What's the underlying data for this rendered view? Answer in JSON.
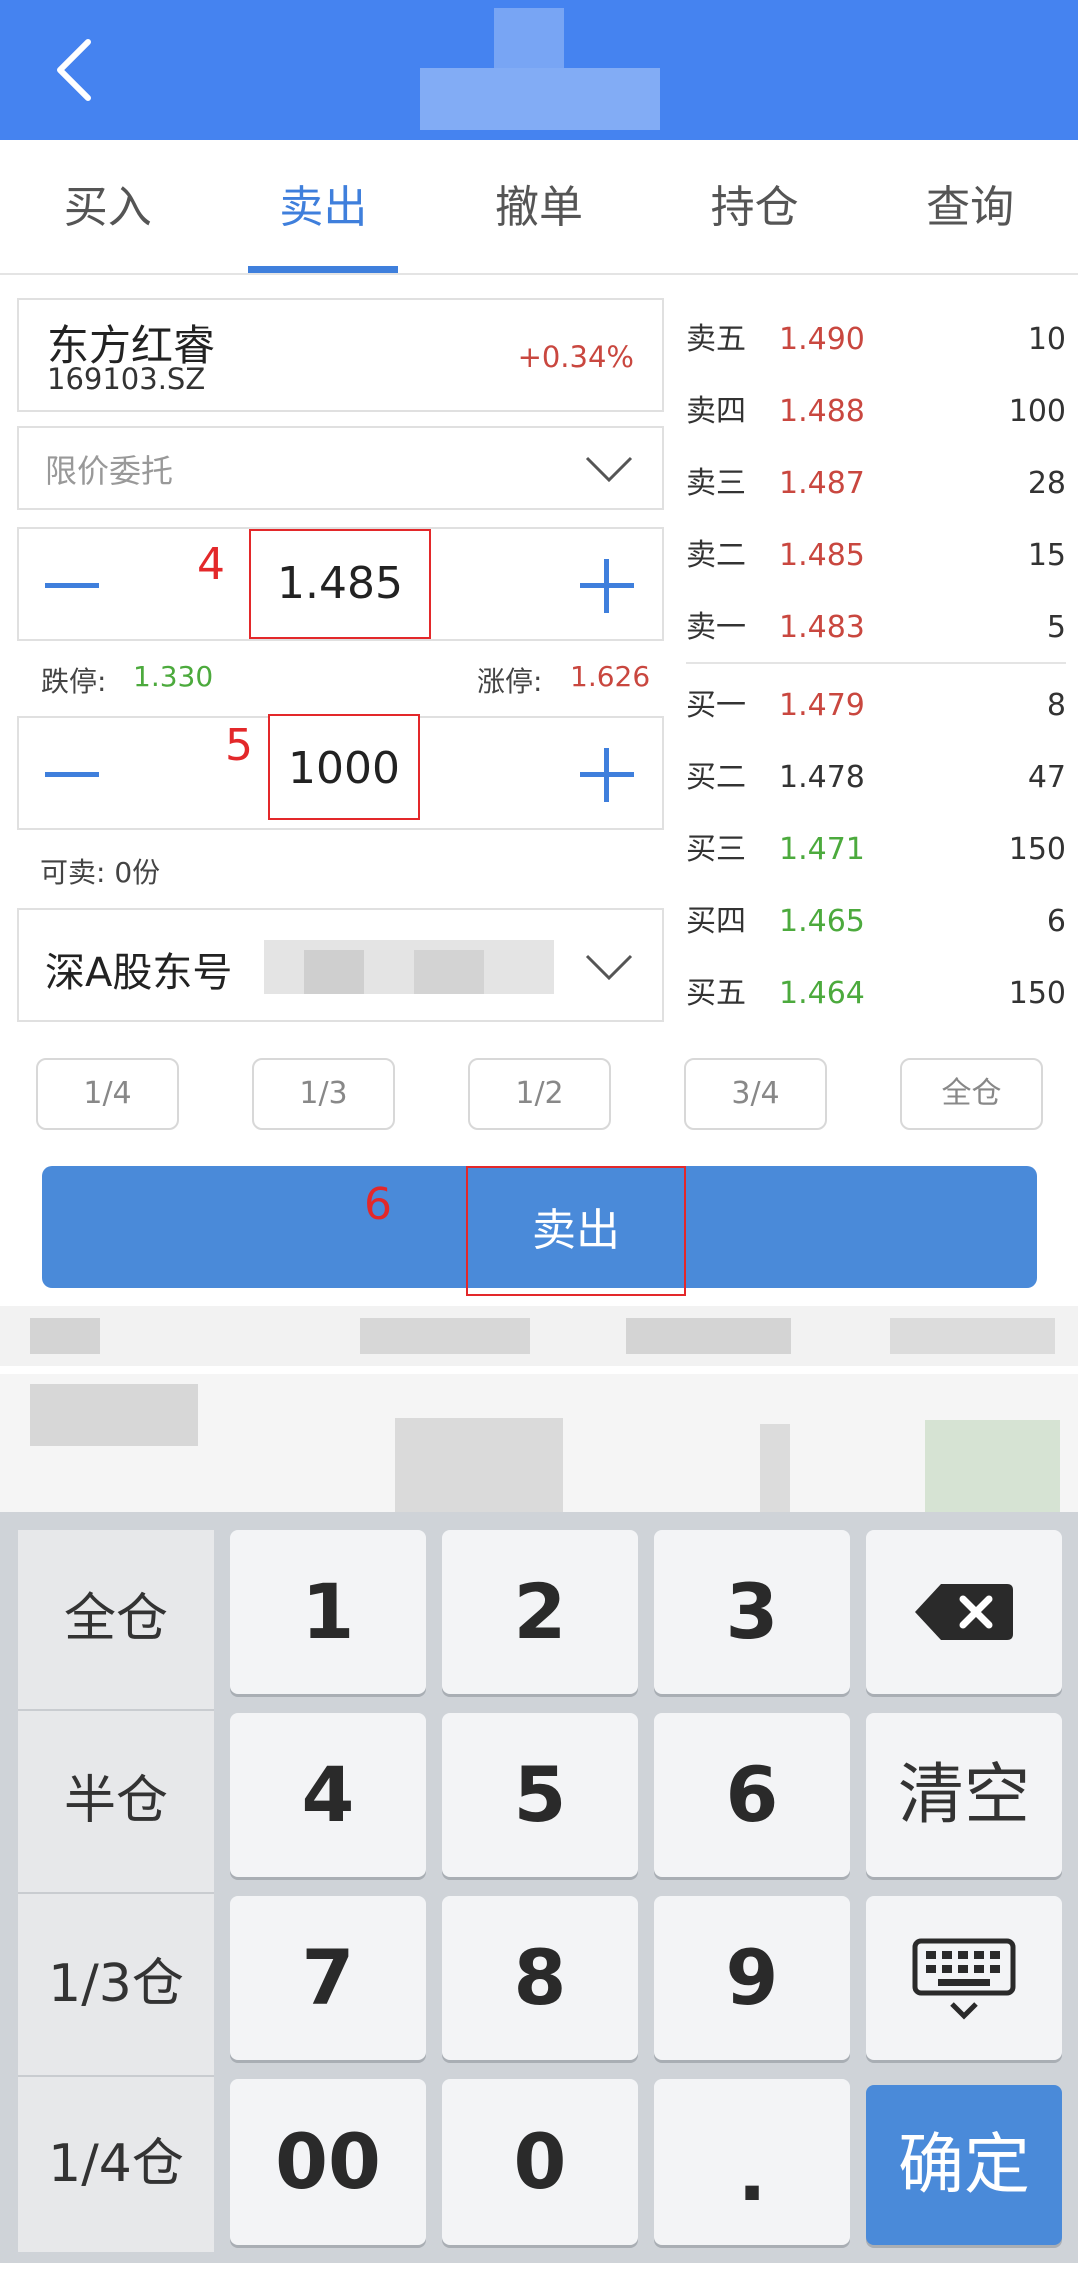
{
  "tabs": [
    {
      "label": "买入"
    },
    {
      "label": "卖出"
    },
    {
      "label": "撤单"
    },
    {
      "label": "持仓"
    },
    {
      "label": "查询"
    }
  ],
  "stock": {
    "name": "东方红睿",
    "code": "169103.SZ",
    "change": "+0.34%"
  },
  "order_type": "限价委托",
  "price": {
    "value": "1.485",
    "annotation": "4",
    "limit_down_label": "跌停:",
    "limit_down": "1.330",
    "limit_up_label": "涨停:",
    "limit_up": "1.626"
  },
  "quantity": {
    "value": "1000",
    "annotation": "5",
    "available": "可卖:  0份"
  },
  "account": {
    "label": "深A股东号"
  },
  "order_book": {
    "asks": [
      {
        "side": "卖五",
        "price": "1.490",
        "volume": "10"
      },
      {
        "side": "卖四",
        "price": "1.488",
        "volume": "100"
      },
      {
        "side": "卖三",
        "price": "1.487",
        "volume": "28"
      },
      {
        "side": "卖二",
        "price": "1.485",
        "volume": "15"
      },
      {
        "side": "卖一",
        "price": "1.483",
        "volume": "5"
      }
    ],
    "bids": [
      {
        "side": "买一",
        "price": "1.479",
        "volume": "8"
      },
      {
        "side": "买二",
        "price": "1.478",
        "volume": "47"
      },
      {
        "side": "买三",
        "price": "1.471",
        "volume": "150"
      },
      {
        "side": "买四",
        "price": "1.465",
        "volume": "6"
      },
      {
        "side": "买五",
        "price": "1.464",
        "volume": "150"
      }
    ]
  },
  "ratio_buttons": [
    "1/4",
    "1/3",
    "1/2",
    "3/4",
    "全仓"
  ],
  "sell_button": {
    "label": "卖出",
    "annotation": "6"
  },
  "keyboard": {
    "side_keys": [
      "全仓",
      "半仓",
      "1/3仓",
      "1/4仓"
    ],
    "digits": [
      "1",
      "2",
      "3",
      "4",
      "5",
      "6",
      "7",
      "8",
      "9"
    ],
    "double_zero": "00",
    "zero": "0",
    "dot": ".",
    "clear": "清空",
    "confirm": "确定"
  },
  "colors": {
    "header": "#4583f0",
    "accent": "#3f7fdc",
    "up": "#c9473f",
    "down": "#4caa3d",
    "annotation": "#e3282a"
  }
}
